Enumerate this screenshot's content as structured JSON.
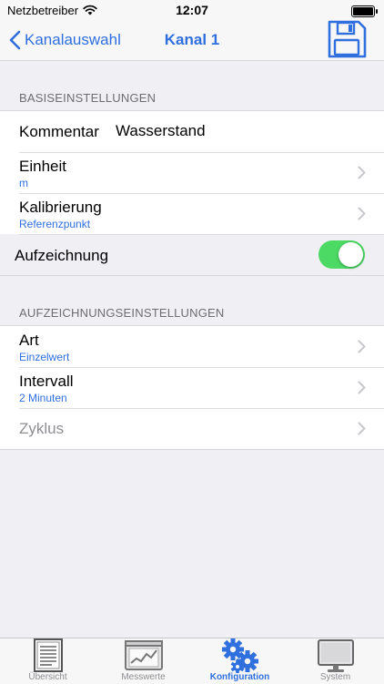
{
  "status_bar": {
    "carrier": "Netzbetreiber",
    "time": "12:07"
  },
  "nav": {
    "back_label": "Kanalauswahl",
    "title": "Kanal 1"
  },
  "sections": {
    "basic": {
      "header": "BASISEINSTELLUNGEN",
      "kommentar_label": "Kommentar",
      "kommentar_value": "Wasserstand",
      "einheit_label": "Einheit",
      "einheit_value": "m",
      "kalibrierung_label": "Kalibrierung",
      "kalibrierung_value": "Referenzpunkt",
      "aufzeichnung_label": "Aufzeichnung",
      "aufzeichnung_on": true
    },
    "recording": {
      "header": "AUFZEICHNUNGSEINSTELLUNGEN",
      "art_label": "Art",
      "art_value": "Einzelwert",
      "intervall_label": "Intervall",
      "intervall_value": "2 Minuten",
      "zyklus_label": "Zyklus"
    }
  },
  "tabs": [
    {
      "label": "Übersicht",
      "icon": "document-icon"
    },
    {
      "label": "Messwerte",
      "icon": "chart-window-icon"
    },
    {
      "label": "Konfiguration",
      "icon": "gears-icon",
      "active": true
    },
    {
      "label": "System",
      "icon": "monitor-icon"
    }
  ],
  "colors": {
    "accent": "#2f6fde",
    "toggle_on": "#4cd964",
    "background": "#efeff4"
  }
}
